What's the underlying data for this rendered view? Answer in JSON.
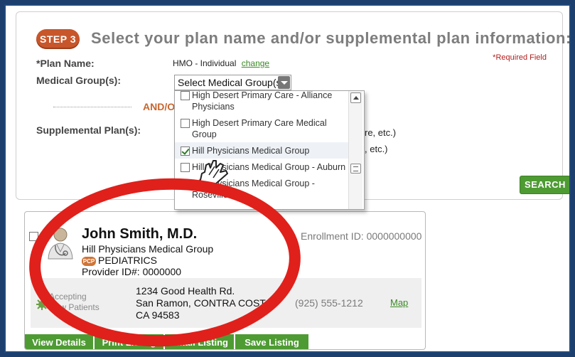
{
  "step": {
    "badge": "STEP 3",
    "title": "Select your plan name and/or supplemental plan information:",
    "required_note": "*Required Field"
  },
  "plan": {
    "label": "*Plan Name:",
    "value": "HMO - Individual",
    "change_link": "change"
  },
  "medical_group": {
    "label": "Medical Group(s):",
    "select_value": "Select Medical Group(s)"
  },
  "and_or": "AND/O",
  "supplemental": {
    "label": "Supplemental Plan(s):",
    "line1_fragment": "re, etc.)",
    "line2_fragment": ", etc.)"
  },
  "search_button": "SEARCH",
  "dropdown": {
    "items": [
      {
        "label": "High Desert Primary Care - Alliance Physicians",
        "checked": false
      },
      {
        "label": "High Desert Primary Care Medical Group",
        "checked": false
      },
      {
        "label": "Hill Physicians Medical Group",
        "checked": true
      },
      {
        "label": "Hill Physicians Medical Group - Auburn",
        "checked": false
      },
      {
        "label": "Hill Physicians Medical Group - Roseville",
        "checked": false
      }
    ]
  },
  "provider": {
    "name": "John Smith, M.D.",
    "group": "Hill Physicians Medical Group",
    "pcp_badge": "PCP",
    "specialty": "PEDIATRICS",
    "provider_id": "Provider ID#: 0000000",
    "enrollment_id": "Enrollment ID: 0000000000",
    "accepting_line1": "Accepting",
    "accepting_line2": "New Patients",
    "address_line1": "1234 Good Health Rd.",
    "address_line2": "San Ramon, CONTRA COSTA",
    "address_line3": "CA 94583",
    "phone": "(925) 555-1212",
    "map_link": "Map"
  },
  "actions": {
    "view_details": "View Details",
    "print_listing": "Print Listing",
    "email_listing": "Email Listing",
    "save_listing": "Save Listing"
  },
  "colors": {
    "frame": "#1c3f6e",
    "step_badge": "#c8562b",
    "accent_green": "#4e9b33",
    "annotation_red": "#e0201b"
  }
}
